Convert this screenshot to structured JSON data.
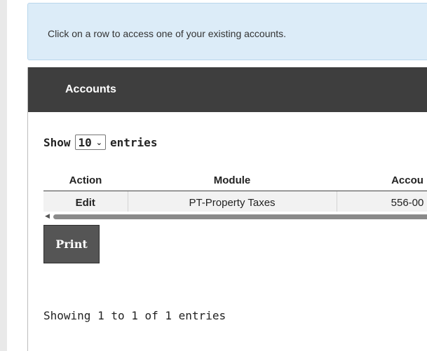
{
  "info": {
    "message": "Click on a row to access one of your existing accounts."
  },
  "panel": {
    "title": "Accounts"
  },
  "length_menu": {
    "prefix": "Show",
    "selected": "10",
    "suffix": "entries"
  },
  "table": {
    "columns": [
      "Action",
      "Module",
      "Accou"
    ],
    "rows": [
      {
        "action": "Edit",
        "module": "PT-Property Taxes",
        "account": "556-00"
      }
    ]
  },
  "print_label": "Print",
  "footer_info": "Showing 1 to 1 of 1 entries",
  "colors": {
    "info_bg": "#dcecf8",
    "header_bg": "#3e3e3e",
    "button_bg": "#555555"
  }
}
